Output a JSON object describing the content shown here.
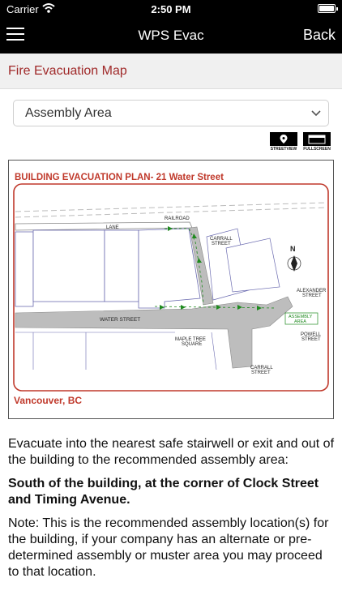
{
  "status": {
    "carrier": "Carrier",
    "time": "2:50 PM"
  },
  "nav": {
    "title": "WPS Evac",
    "back_label": "Back"
  },
  "section": {
    "title": "Fire Evacuation Map"
  },
  "dropdown": {
    "selected": "Assembly Area"
  },
  "buttons": {
    "streetview": "STREETVIEW",
    "fullscreen": "FULLSCREEN"
  },
  "map": {
    "title": "BUILDING EVACUATION PLAN- 21 Water Street",
    "city": "Vancouver, BC",
    "labels": {
      "railroad": "RAILROAD",
      "lane": "LANE",
      "carrall1": "CARRALL",
      "street": "STREET",
      "north": "N",
      "alexander": "ALEXANDER",
      "water_street": "WATER STREET",
      "assembly": "ASSEMBLY",
      "area": "AREA",
      "maple_tree": "MAPLE TREE",
      "square": "SQUARE",
      "powell": "POWELL",
      "carrall2": "CARRALL"
    }
  },
  "content": {
    "p1": "Evacuate into the nearest safe stairwell or exit and out of the building to the recommended assembly area:",
    "p2": "South of the building, at the corner of Clock Street and Timing Avenue.",
    "p3": "Note: This is the recommended assembly location(s) for the building, if your company has an alternate or pre-determined assembly or muster area you may proceed to that location."
  },
  "colors": {
    "accent": "#a02a2a",
    "map_red": "#c0392b",
    "route_green": "#1e8a1e"
  }
}
